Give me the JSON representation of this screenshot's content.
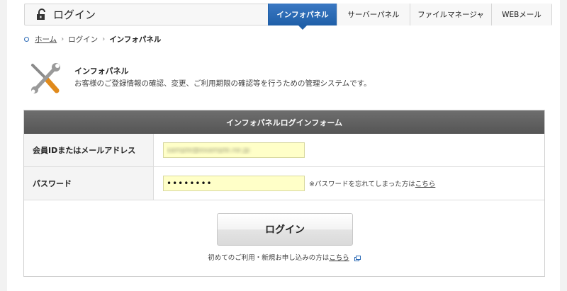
{
  "header": {
    "title": "ログイン",
    "tabs": [
      {
        "label": "インフォパネル",
        "active": true
      },
      {
        "label": "サーバーパネル",
        "active": false
      },
      {
        "label": "ファイルマネージャ",
        "active": false
      },
      {
        "label": "WEBメール",
        "active": false
      }
    ]
  },
  "breadcrumb": {
    "items": [
      "ホーム",
      "ログイン"
    ],
    "current": "インフォパネル"
  },
  "intro": {
    "title": "インフォパネル",
    "description": "お客様のご登録情報の確認、変更、ご利用期限の確認等を行うための管理システムです。"
  },
  "form": {
    "heading": "インフォパネルログインフォーム",
    "id_label": "会員IDまたはメールアドレス",
    "id_value": "sample@example.ne.jp",
    "password_label": "パスワード",
    "password_value": "••••••••",
    "forgot_text": "※パスワードを忘れてしまった方は",
    "forgot_link": "こちら",
    "login_button": "ログイン",
    "first_time_text": "初めてのご利用・新規お申し込みの方は",
    "first_time_link": "こちら"
  },
  "colors": {
    "accent": "#1f5fa8",
    "form_header": "#5f5f5f",
    "input_bg": "#ffffc8"
  }
}
